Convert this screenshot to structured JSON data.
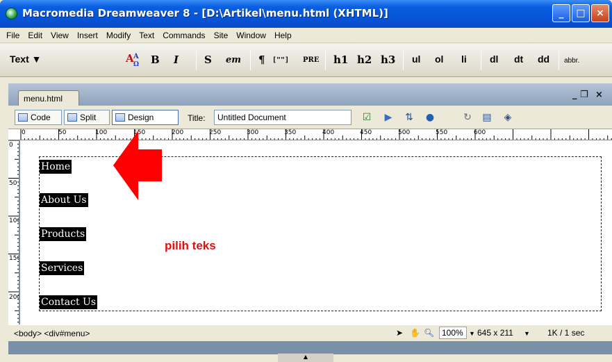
{
  "window": {
    "title": "Macromedia Dreamweaver 8 - [D:\\Artikel\\menu.html (XHTML)]",
    "minimize": "_",
    "maximize": "□",
    "close": "×"
  },
  "menubar": [
    "File",
    "Edit",
    "View",
    "Insert",
    "Modify",
    "Text",
    "Commands",
    "Site",
    "Window",
    "Help"
  ],
  "insert_toolbar": {
    "category": "Text ▼",
    "items": [
      "B",
      "I",
      "S",
      "em",
      "¶",
      "[\"\"]",
      "PRE",
      "h1",
      "h2",
      "h3",
      "ul",
      "ol",
      "li",
      "dl",
      "dt",
      "dd",
      "abbr."
    ]
  },
  "document": {
    "tab_label": "menu.html",
    "tab_restore": "_ ❐",
    "tab_close": "×",
    "view_code": "Code",
    "view_split": "Split",
    "view_design": "Design",
    "title_label": "Title:",
    "title_value": "Untitled Document"
  },
  "ruler": {
    "h_labels": [
      "0",
      "50",
      "100",
      "150",
      "200",
      "250",
      "300",
      "350",
      "400",
      "450",
      "500",
      "550",
      "600"
    ],
    "v_labels": [
      "0",
      "50",
      "100",
      "150",
      "200"
    ]
  },
  "canvas": {
    "links": [
      "Home",
      "About Us",
      "Products",
      "Services",
      "Contact Us"
    ]
  },
  "annotation": {
    "text": "pilih teks",
    "arrow_color": "#ff0000"
  },
  "statusbar": {
    "tag_selector": "<body> <div#menu>",
    "zoom": "100%",
    "window_size": "645 x 211",
    "download": "1K / 1 sec"
  },
  "colors": {
    "titlebar": "#0653d6",
    "chrome": "#ece9d8",
    "link_bg": "#000000",
    "link_text": "#ffffff"
  }
}
